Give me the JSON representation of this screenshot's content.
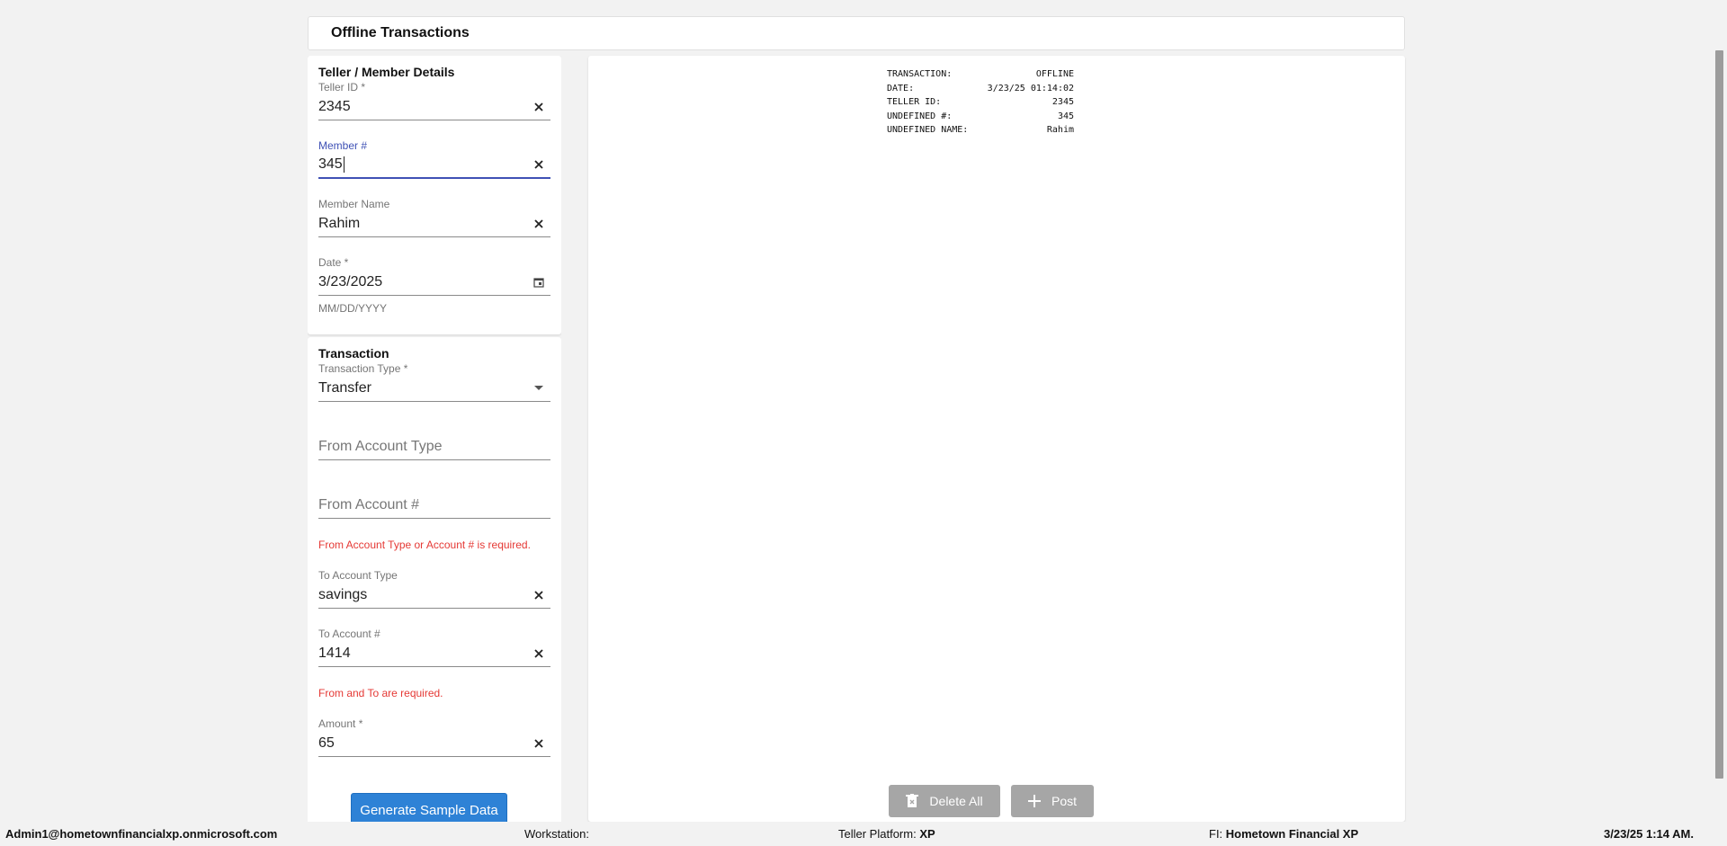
{
  "header": {
    "title": "Offline Transactions"
  },
  "teller_card": {
    "title": "Teller / Member Details",
    "teller_id": {
      "label": "Teller ID *",
      "value": "2345"
    },
    "member_num": {
      "label": "Member #",
      "value": "345"
    },
    "member_name": {
      "label": "Member Name",
      "value": "Rahim"
    },
    "date": {
      "label": "Date *",
      "value": "3/23/2025",
      "hint": "MM/DD/YYYY"
    }
  },
  "transaction_card": {
    "title": "Transaction",
    "type": {
      "label": "Transaction Type *",
      "value": "Transfer"
    },
    "from_account_type": {
      "placeholder": "From Account Type"
    },
    "from_account_num": {
      "placeholder": "From Account #"
    },
    "from_error": "From Account Type or Account # is required.",
    "to_account_type": {
      "label": "To Account Type",
      "value": "savings"
    },
    "to_account_num": {
      "label": "To Account #",
      "value": "1414"
    },
    "to_error": "From and To are required.",
    "amount": {
      "label": "Amount *",
      "value": "65"
    }
  },
  "generate_button": "Generate Sample Data",
  "receipt": {
    "rows": [
      {
        "key": "TRANSACTION:",
        "value": "OFFLINE"
      },
      {
        "key": "DATE:",
        "value": "3/23/25 01:14:02"
      },
      {
        "key": "TELLER ID:",
        "value": "2345"
      },
      {
        "key": "UNDEFINED #:",
        "value": "345"
      },
      {
        "key": "UNDEFINED NAME:",
        "value": "Rahim"
      }
    ]
  },
  "actions": {
    "delete_all": "Delete All",
    "post": "Post"
  },
  "status_bar": {
    "user": "Admin1@hometownfinancialxp.onmicrosoft.com",
    "workstation_label": "Workstation:",
    "workstation_value": "",
    "platform_label": "Teller Platform:",
    "platform_value": "XP",
    "fi_label": "FI:",
    "fi_value": "Hometown Financial XP",
    "datetime": "3/23/25 1:14 AM."
  },
  "colors": {
    "accent": "#3f51b5",
    "primary_button": "#2e82d6",
    "error": "#e53935",
    "disabled_button": "#a6a6a6"
  },
  "icons": [
    "clear-icon",
    "calendar-icon",
    "dropdown-arrow-icon",
    "trash-icon",
    "plus-icon"
  ]
}
